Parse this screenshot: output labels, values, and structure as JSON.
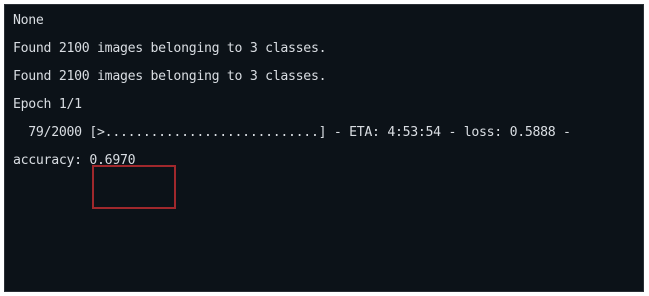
{
  "console": {
    "lines": [
      "None",
      "Found 2100 images belonging to 3 classes.",
      "Found 2100 images belonging to 3 classes.",
      "Epoch 1/1",
      "  79/2000 [>............................] - ETA: 4:53:54 - loss: 0.5888 -",
      "accuracy: 0.6970"
    ]
  },
  "colors": {
    "background": "#0c1218",
    "text": "#d9dde2",
    "highlight_border": "#a0282c"
  }
}
